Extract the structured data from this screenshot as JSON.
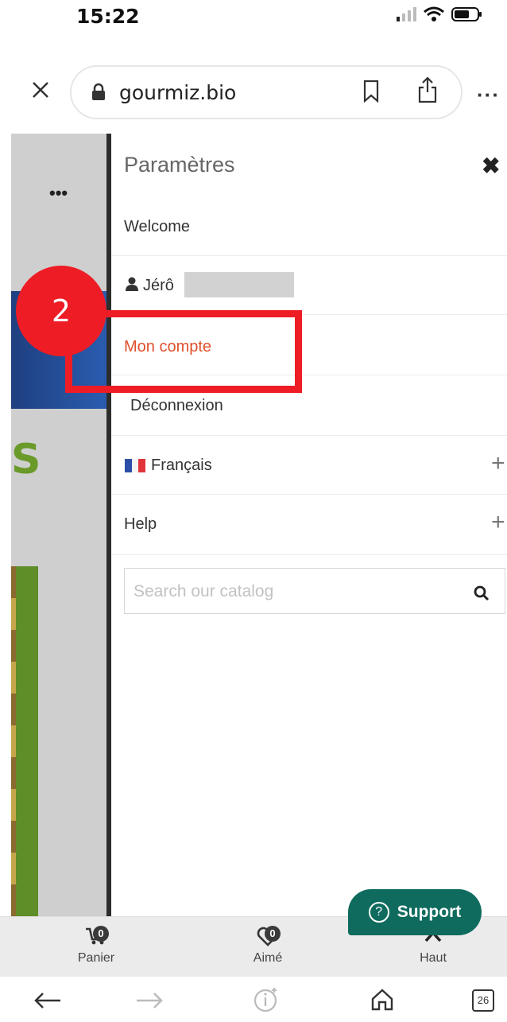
{
  "status_bar": {
    "time": "15:22"
  },
  "browser": {
    "url": "gourmiz.bio",
    "tab_count": "26"
  },
  "background_page": {
    "more_dots": "•••",
    "partial_logo_text": "S"
  },
  "drawer": {
    "title": "Paramètres",
    "close_icon": "✖",
    "items": {
      "welcome": "Welcome",
      "user_name": "Jérô",
      "account": "Mon compte",
      "logout": "Déconnexion",
      "language": "Français",
      "help": "Help"
    },
    "expand_symbol": "+",
    "search_placeholder": "Search our catalog"
  },
  "annotation": {
    "step_number": "2"
  },
  "site_nav": {
    "cart": {
      "label": "Panier",
      "count": "0"
    },
    "liked": {
      "label": "Aimé",
      "count": "0"
    },
    "top": {
      "label": "Haut"
    }
  },
  "support": {
    "label": "Support",
    "icon_text": "?"
  },
  "colors": {
    "accent_red": "#ee1c25",
    "link_orange": "#e0502d",
    "support_teal": "#0e6b5e"
  }
}
